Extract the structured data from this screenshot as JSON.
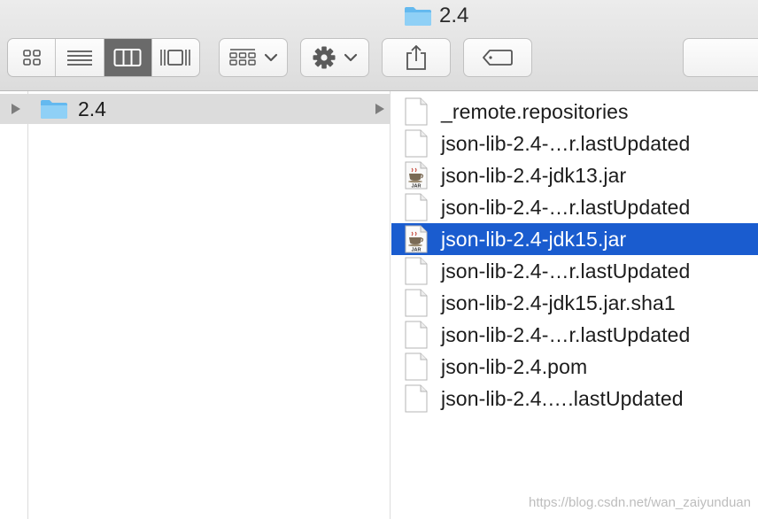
{
  "window": {
    "title": "2.4",
    "title_icon": "folder-icon"
  },
  "toolbar": {
    "view_modes": [
      {
        "name": "icon-view",
        "icon": "grid-icon",
        "active": false
      },
      {
        "name": "list-view",
        "icon": "list-icon",
        "active": false
      },
      {
        "name": "column-view",
        "icon": "columns-icon",
        "active": true
      },
      {
        "name": "gallery-view",
        "icon": "coverflow-icon",
        "active": false
      }
    ],
    "group_button_icon": "group-by-icon",
    "action_button_icon": "gear-icon",
    "share_button_icon": "share-icon",
    "tag_button_icon": "tag-icon"
  },
  "sidebar_column": {
    "folder": {
      "name": "2.4",
      "icon": "folder-icon"
    }
  },
  "files": [
    {
      "name": "_remote.repositories",
      "type": "document",
      "selected": false
    },
    {
      "name": "json-lib-2.4-…r.lastUpdated",
      "type": "document",
      "selected": false
    },
    {
      "name": "json-lib-2.4-jdk13.jar",
      "type": "jar",
      "selected": false
    },
    {
      "name": "json-lib-2.4-…r.lastUpdated",
      "type": "document",
      "selected": false
    },
    {
      "name": "json-lib-2.4-jdk15.jar",
      "type": "jar",
      "selected": true
    },
    {
      "name": "json-lib-2.4-…r.lastUpdated",
      "type": "document",
      "selected": false
    },
    {
      "name": "json-lib-2.4-jdk15.jar.sha1",
      "type": "document",
      "selected": false
    },
    {
      "name": "json-lib-2.4-…r.lastUpdated",
      "type": "document",
      "selected": false
    },
    {
      "name": "json-lib-2.4.pom",
      "type": "document",
      "selected": false
    },
    {
      "name": "json-lib-2.4.….lastUpdated",
      "type": "document",
      "selected": false
    }
  ],
  "jar_badge": "JAR",
  "watermark": "https://blog.csdn.net/wan_zaiyunduan",
  "colors": {
    "selection": "#1a5ccf",
    "folder": "#5fb8ef",
    "active_segment": "#6a6a6a"
  }
}
